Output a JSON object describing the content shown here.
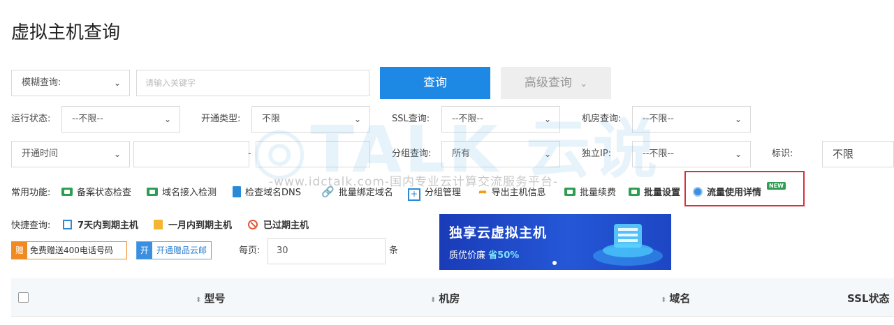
{
  "page_title": "虚拟主机查询",
  "search": {
    "mode": "模糊查询:",
    "placeholder": "请输入关键字",
    "query_button": "查询",
    "advanced_button": "高级查询"
  },
  "filters": {
    "run_status": {
      "label": "运行状态:",
      "value": "--不限--"
    },
    "open_type": {
      "label": "开通类型:",
      "value": "不限"
    },
    "ssl": {
      "label": "SSL查询:",
      "value": "--不限--"
    },
    "datacenter": {
      "label": "机房查询:",
      "value": "--不限--"
    },
    "open_time": {
      "value": "开通时间",
      "separator": "-"
    },
    "group": {
      "label": "分组查询:",
      "value": "所有"
    },
    "dedicated_ip": {
      "label": "独立IP:",
      "value": "--不限--"
    },
    "tag": {
      "label": "标识:",
      "value": "不限"
    }
  },
  "common_functions": {
    "label": "常用功能:",
    "items": [
      "备案状态检查",
      "域名接入检测",
      "检查域名DNS",
      "批量绑定域名",
      "分组管理",
      "导出主机信息",
      "批量续费",
      "批量设置",
      "流量使用详情"
    ],
    "new_badge": "NEW"
  },
  "watermark": "-www.idctalk.com-国内专业云计算交流服务平台-",
  "quick_query": {
    "label": "快捷查询:",
    "items": [
      "7天内到期主机",
      "一月内到期主机",
      "已过期主机"
    ]
  },
  "promos": {
    "phone": {
      "tag": "赠",
      "text": "免费赠送400电话号码"
    },
    "mail": {
      "tag": "开",
      "text": "开通赠品云邮"
    }
  },
  "per_page": {
    "label": "每页:",
    "value": "30",
    "unit": "条"
  },
  "banner": {
    "title": "独享云虚拟主机",
    "subtitle": "质优价廉",
    "discount": "省50%"
  },
  "table": {
    "columns": [
      "型号",
      "机房",
      "域名",
      "SSL状态"
    ]
  }
}
